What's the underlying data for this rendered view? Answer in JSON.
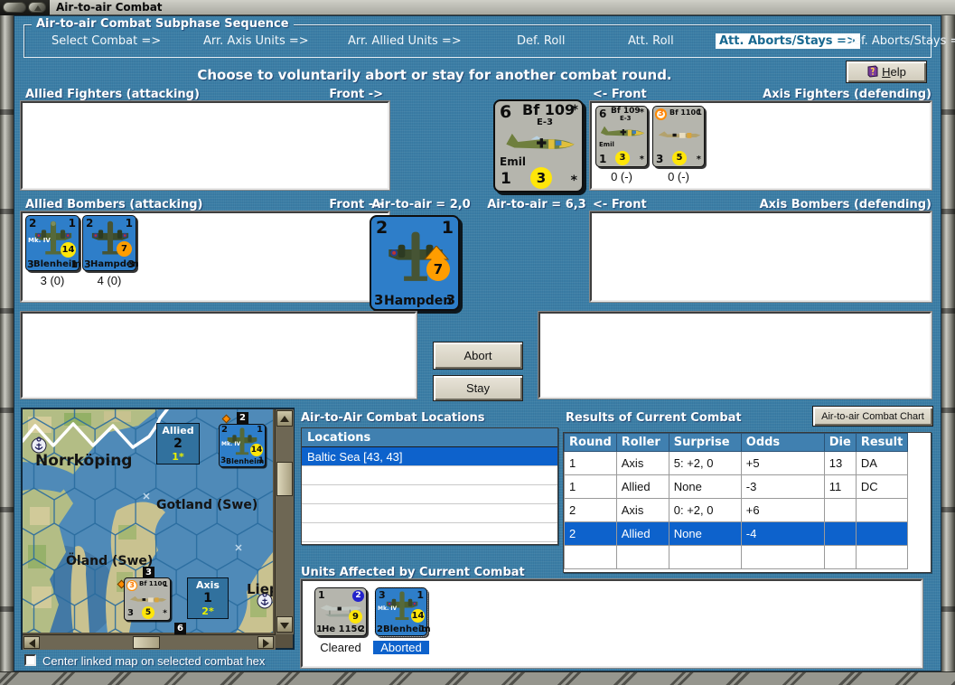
{
  "window": {
    "title": "Air-to-air Combat"
  },
  "subphase": {
    "title": "Air-to-air Combat Subphase Sequence",
    "steps": [
      {
        "label": "Select Combat =>"
      },
      {
        "label": "Arr. Axis Units =>"
      },
      {
        "label": "Arr. Allied Units =>"
      },
      {
        "label": "Def. Roll"
      },
      {
        "label": "Att. Roll"
      },
      {
        "label": "Att. Aborts/Stays =>"
      },
      {
        "label": "Def. Aborts/Stays =>"
      }
    ],
    "active_step": "Att. Aborts/Stays =>"
  },
  "instruction": "Choose to voluntarily abort or stay for another combat round.",
  "help_button": "Help",
  "fighters_row": {
    "allied": "Allied Fighters (attacking)",
    "front_right": "Front ->",
    "front_left": "<- Front",
    "axis": "Axis Fighters (defending)"
  },
  "bombers_row": {
    "allied": "Allied Bombers (attacking)",
    "front_right": "Front ->",
    "attacker_air": "Air-to-air = 2,0",
    "defender_air": "Air-to-air = 6,3",
    "front_left": "<- Front",
    "axis": "Axis Bombers (defending)"
  },
  "center_fighter": {
    "tl": "6",
    "name": "Bf 109",
    "sub": "E-3",
    "tr": "*",
    "variant": "Emil",
    "bl": "1",
    "circle": "3",
    "br": "*"
  },
  "center_bomber": {
    "tl": "2",
    "tr": "1",
    "bl": "3",
    "name": "Hampden",
    "br": "3",
    "circle": "7"
  },
  "axis_fighters": [
    {
      "tl": "6",
      "name": "Bf 109",
      "sub": "E-3",
      "tr": "*",
      "variant": "Emil",
      "bl": "1",
      "circle": "3",
      "br": "*",
      "below": "0 (-)"
    },
    {
      "tl": "3",
      "name": "Bf 110C",
      "tr": "1",
      "bl": "3",
      "circle": "5",
      "br": "*",
      "below": "0 (-)"
    }
  ],
  "allied_bombers": [
    {
      "tl": "2",
      "tr": "1",
      "type": "Mk. IV",
      "circle": "14",
      "bl": "3",
      "name": "Blenheim",
      "br": "1",
      "below": "3 (0)"
    },
    {
      "tl": "2",
      "tr": "1",
      "circle": "7",
      "bl": "3",
      "name": "Hampden",
      "br": "3",
      "below": "4 (0)"
    }
  ],
  "actions": {
    "abort": "Abort",
    "stay": "Stay"
  },
  "map": {
    "labels": {
      "norrkoping": "Norrköping",
      "gotland": "Gotland (Swe)",
      "oland": "Öland (Swe)",
      "liepaja": "Liep"
    },
    "allied_stack": {
      "side": "Allied",
      "count": "2",
      "air": "1*"
    },
    "axis_stack": {
      "side": "Axis",
      "count": "1",
      "air": "2*"
    },
    "allied_counter": {
      "tl": "2",
      "tr": "1",
      "type": "Mk. IV",
      "circle": "14",
      "bl": "3",
      "name": "Blenheim",
      "br": "1",
      "badge": "2"
    },
    "axis_counter": {
      "tl": "3",
      "name": "Bf 110C",
      "tr": "1",
      "bl": "3",
      "circle": "5",
      "br": "*",
      "badge_top": "3",
      "badge_bottom": "6"
    },
    "checkbox_label": "Center linked map on selected combat hex"
  },
  "locations": {
    "title": "Air-to-Air Combat Locations",
    "header": "Locations",
    "selected": "Baltic Sea [43, 43]"
  },
  "results": {
    "title": "Results of Current Combat",
    "chart_button": "Air-to-air Combat Chart",
    "headers": [
      "Round",
      "Roller",
      "Surprise",
      "Odds",
      "Die",
      "Result"
    ],
    "rows": [
      [
        "1",
        "Axis",
        "5: +2, 0",
        "+5",
        "13",
        "DA"
      ],
      [
        "1",
        "Allied",
        "None",
        "-3",
        "11",
        "DC"
      ],
      [
        "2",
        "Axis",
        "0: +2, 0",
        "+6",
        "",
        ""
      ],
      [
        "2",
        "Allied",
        "None",
        "-4",
        "",
        ""
      ]
    ],
    "selected_row_index": 3
  },
  "affected": {
    "title": "Units Affected by Current Combat",
    "units": [
      {
        "tl": "1",
        "tr_circle": "2",
        "circle": "9",
        "bl": "1",
        "name": "He 115C",
        "br": "2",
        "status": "Cleared"
      },
      {
        "tl": "3",
        "tr": "1",
        "type": "Mk. IV",
        "circle": "14",
        "bl": "2",
        "name": "Blenheim",
        "br": "1",
        "status": "Aborted"
      }
    ]
  }
}
